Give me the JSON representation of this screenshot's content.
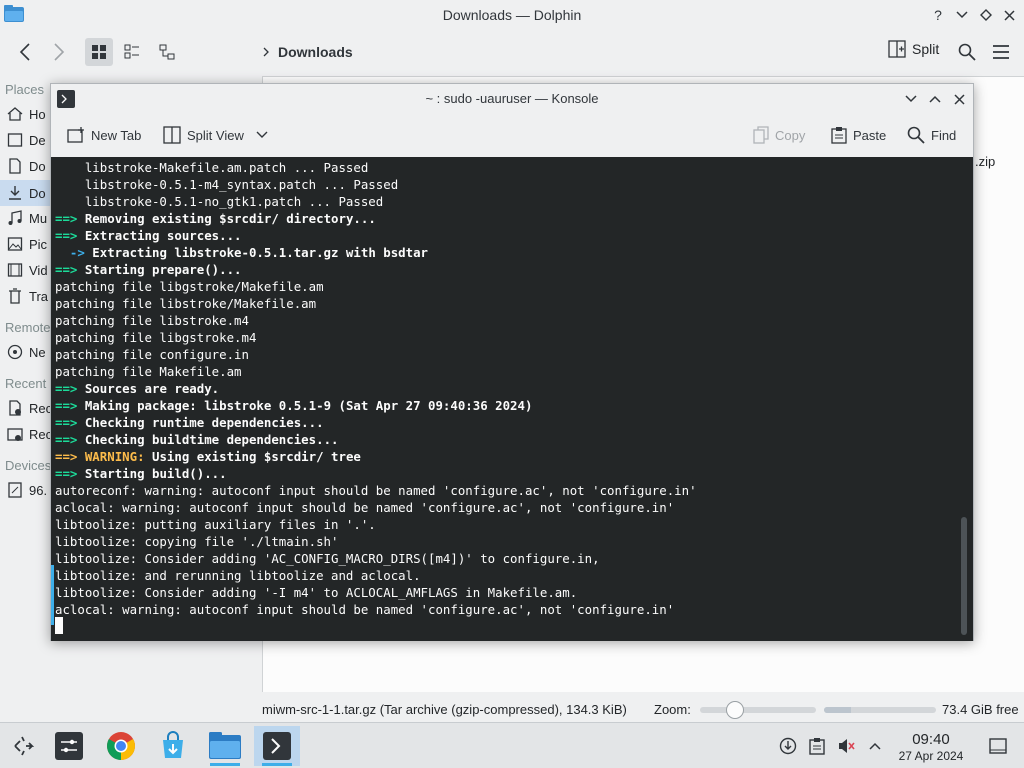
{
  "dolphin": {
    "title": "Downloads — Dolphin",
    "breadcrumb": "Downloads",
    "split_label": "Split",
    "places_header": "Places",
    "remote_header": "Remote",
    "recent_header": "Recent",
    "devices_header": "Devices",
    "places": [
      "Ho",
      "De",
      "Do",
      "Do",
      "Mu",
      "Pic",
      "Vid",
      "Tra"
    ],
    "remote": [
      "Ne"
    ],
    "recent": [
      "Rec",
      "Rec"
    ],
    "devices": [
      "96."
    ],
    "file_partial": ".zip",
    "status_file": "miwm-src-1-1.tar.gz (Tar archive (gzip-compressed), 134.3 KiB)",
    "zoom_label": "Zoom:",
    "zoom_level": 0.3,
    "free_space": "73.4 GiB free"
  },
  "konsole": {
    "title": "~ : sudo -uauruser — Konsole",
    "new_tab": "New Tab",
    "split_view": "Split View",
    "copy": "Copy",
    "paste": "Paste",
    "find": "Find",
    "lines": [
      {
        "t": "plain",
        "text": "    libstroke-Makefile.am.patch ... Passed"
      },
      {
        "t": "plain",
        "text": "    libstroke-0.5.1-m4_syntax.patch ... Passed"
      },
      {
        "t": "plain",
        "text": "    libstroke-0.5.1-no_gtk1.patch ... Passed"
      },
      {
        "t": "step",
        "arrow": "==>",
        "text": " Removing existing $srcdir/ directory..."
      },
      {
        "t": "step",
        "arrow": "==>",
        "text": " Extracting sources..."
      },
      {
        "t": "sub",
        "arrow": "  ->",
        "text": " Extracting libstroke-0.5.1.tar.gz with bsdtar"
      },
      {
        "t": "step",
        "arrow": "==>",
        "text": " Starting prepare()..."
      },
      {
        "t": "plain",
        "text": "patching file libgstroke/Makefile.am"
      },
      {
        "t": "plain",
        "text": "patching file libstroke/Makefile.am"
      },
      {
        "t": "plain",
        "text": "patching file libstroke.m4"
      },
      {
        "t": "plain",
        "text": "patching file libgstroke.m4"
      },
      {
        "t": "plain",
        "text": "patching file configure.in"
      },
      {
        "t": "plain",
        "text": "patching file Makefile.am"
      },
      {
        "t": "step",
        "arrow": "==>",
        "text": " Sources are ready."
      },
      {
        "t": "step",
        "arrow": "==>",
        "text": " Making package: libstroke 0.5.1-9 (Sat Apr 27 09:40:36 2024)"
      },
      {
        "t": "step",
        "arrow": "==>",
        "text": " Checking runtime dependencies..."
      },
      {
        "t": "step",
        "arrow": "==>",
        "text": " Checking buildtime dependencies..."
      },
      {
        "t": "warning",
        "arrow": "==>",
        "warn": " WARNING:",
        "text": " Using existing $srcdir/ tree"
      },
      {
        "t": "step",
        "arrow": "==>",
        "text": " Starting build()..."
      },
      {
        "t": "plain",
        "text": "autoreconf: warning: autoconf input should be named 'configure.ac', not 'configure.in'"
      },
      {
        "t": "plain",
        "text": "aclocal: warning: autoconf input should be named 'configure.ac', not 'configure.in'"
      },
      {
        "t": "plain",
        "text": "libtoolize: putting auxiliary files in '.'."
      },
      {
        "t": "plain",
        "text": "libtoolize: copying file './ltmain.sh'"
      },
      {
        "t": "plain",
        "text": "libtoolize: Consider adding 'AC_CONFIG_MACRO_DIRS([m4])' to configure.in,"
      },
      {
        "t": "plain",
        "text": "libtoolize: and rerunning libtoolize and aclocal."
      },
      {
        "t": "plain",
        "text": "libtoolize: Consider adding '-I m4' to ACLOCAL_AMFLAGS in Makefile.am."
      },
      {
        "t": "plain",
        "text": "aclocal: warning: autoconf input should be named 'configure.ac', not 'configure.in'"
      }
    ]
  },
  "taskbar": {
    "time": "09:40",
    "date": "27 Apr 2024"
  },
  "colors": {
    "accent": "#3daee9",
    "terminal_bg": "#232627",
    "prompt_green": "#1cdc9a",
    "warning_yellow": "#fdbc4b"
  }
}
